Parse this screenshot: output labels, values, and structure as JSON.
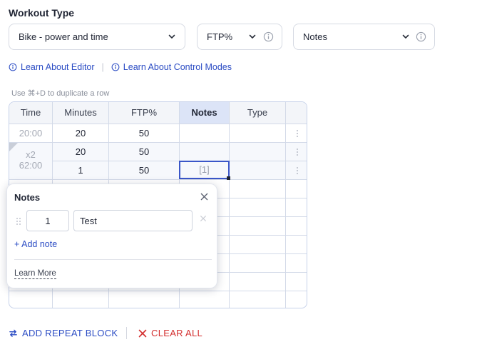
{
  "workout_type": {
    "title": "Workout Type",
    "sport_select": "Bike - power and time",
    "mode_select": "FTP%",
    "notes_select": "Notes"
  },
  "links": {
    "editor": "Learn About Editor",
    "separator": "|",
    "control_modes": "Learn About Control Modes"
  },
  "hint": "Use ⌘+D to duplicate a row",
  "table": {
    "headers": [
      "Time",
      "Minutes",
      "FTP%",
      "Notes",
      "Type"
    ],
    "rows": [
      {
        "time": "20:00",
        "minutes": "20",
        "ftp": "50",
        "notes": "",
        "type": ""
      },
      {
        "time": "",
        "minutes": "20",
        "ftp": "50",
        "notes": "",
        "type": ""
      },
      {
        "time": "",
        "minutes": "1",
        "ftp": "50",
        "notes": "[1]",
        "type": ""
      }
    ],
    "repeat_label": "x2",
    "repeat_time": "62:00",
    "row_menu_icon": "kebab-vertical-icon"
  },
  "notes_popup": {
    "title": "Notes",
    "note_index": "1",
    "note_text": "Test",
    "add_note": "Add note",
    "learn_more": "Learn More"
  },
  "actions": {
    "add_repeat_block": "ADD REPEAT BLOCK",
    "clear_all": "CLEAR ALL"
  },
  "colors": {
    "accent": "#2b4cc4",
    "danger": "#d32f2f",
    "active_header": "#dce4f7",
    "selected_cell_border": "#3a56c8"
  }
}
